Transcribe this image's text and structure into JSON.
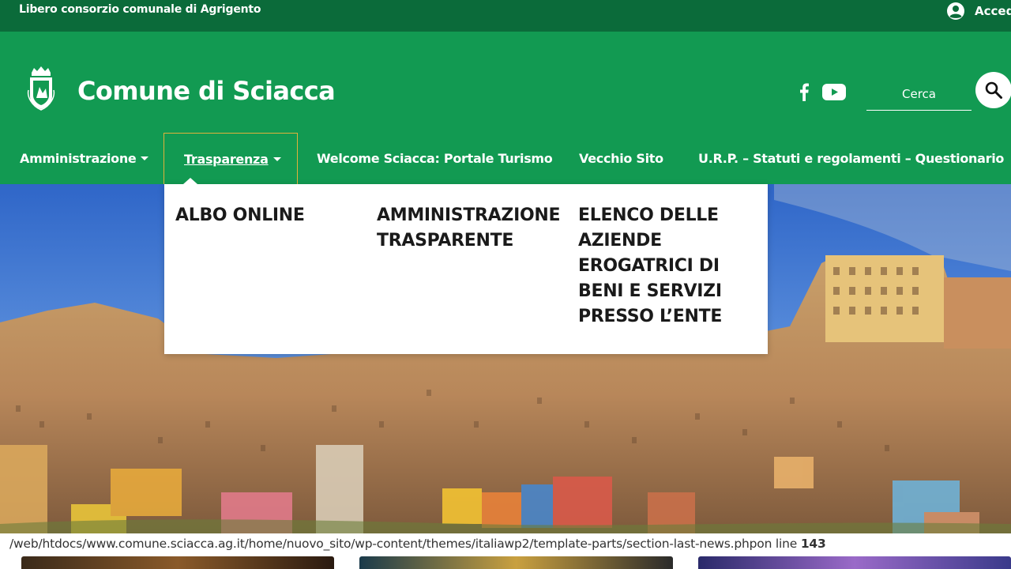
{
  "topbar": {
    "region": "Libero consorzio comunale di Agrigento",
    "login_label": "Accedi"
  },
  "header": {
    "site_title": "Comune di Sciacca",
    "search_placeholder": "Cerca"
  },
  "nav": {
    "items": [
      {
        "label": "Amministrazione",
        "has_caret": true
      },
      {
        "label": "Trasparenza",
        "has_caret": true,
        "active": true
      },
      {
        "label": "Welcome Sciacca: Portale Turismo"
      },
      {
        "label": "Vecchio Sito"
      },
      {
        "label": "U.R.P. – Statuti e regolamenti – Questionario"
      }
    ]
  },
  "dropdown": {
    "items": [
      {
        "label": "ALBO ONLINE"
      },
      {
        "label": "AMMINISTRAZIONE TRASPARENTE"
      },
      {
        "label": "ELENCO DELLE AZIENDE EROGATRICI DI BENI E SERVIZI PRESSO L’ENTE"
      }
    ]
  },
  "status": {
    "path": "/web/htdocs/www.comune.sciacca.ag.it/home/nuovo_sito/wp-content/themes/italiawp2/template-parts/section-last-news.php",
    "suffix": "on line ",
    "line": "143"
  },
  "colors": {
    "topbar_bg": "#0b6b3a",
    "header_bg": "#129a52",
    "active_border": "#e0b23a"
  },
  "icons": [
    "user-circle-icon",
    "coat-of-arms-logo",
    "facebook-icon",
    "youtube-icon",
    "search-icon"
  ]
}
